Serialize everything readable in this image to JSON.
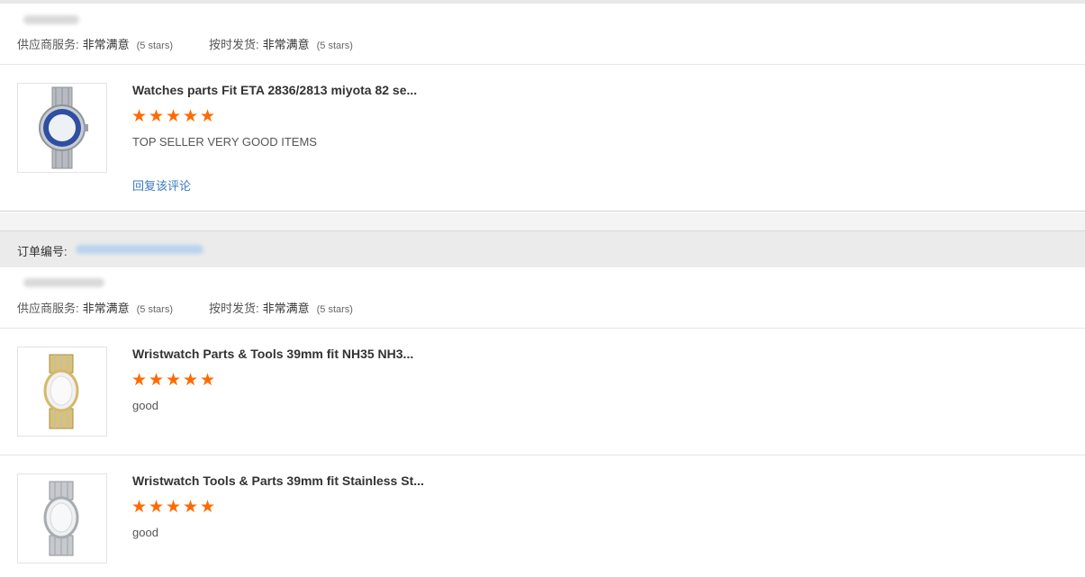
{
  "colors": {
    "accent_star": "#ff6a00",
    "link": "#3a7bbf",
    "band": "#ebebeb"
  },
  "order1": {
    "supplier_service_label": "供应商服务:",
    "supplier_service_value": "非常满意",
    "supplier_service_stars": "(5 stars)",
    "shipping_label": "按时发货:",
    "shipping_value": "非常满意",
    "shipping_stars": "(5 stars)",
    "items": [
      {
        "thumb_icon": "watch-blue-bezel-icon",
        "title": "Watches parts Fit ETA 2836/2813 miyota 82 se...",
        "rating": 5,
        "review": "TOP SELLER VERY GOOD ITEMS",
        "reply_label": "回复该评论"
      }
    ]
  },
  "order2": {
    "order_number_label": "订单编号:",
    "supplier_service_label": "供应商服务:",
    "supplier_service_value": "非常满意",
    "supplier_service_stars": "(5 stars)",
    "shipping_label": "按时发货:",
    "shipping_value": "非常满意",
    "shipping_stars": "(5 stars)",
    "items": [
      {
        "thumb_icon": "watch-gold-silver-icon",
        "title": "Wristwatch Parts & Tools 39mm fit NH35 NH3...",
        "rating": 5,
        "review": "good"
      },
      {
        "thumb_icon": "watch-silver-icon",
        "title": "Wristwatch Tools & Parts 39mm fit Stainless St...",
        "rating": 5,
        "review": "good"
      }
    ]
  }
}
